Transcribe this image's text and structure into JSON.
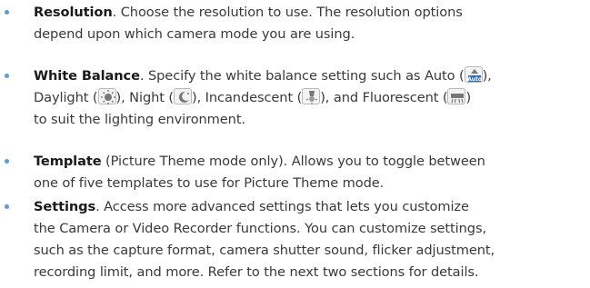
{
  "bullet_color": "#5b9bd5",
  "items": [
    {
      "term": "Resolution",
      "rest": ". Choose the resolution to use. The resolution options",
      "line2": "depend upon which camera mode you are using."
    },
    {
      "term": "White Balance",
      "rest": ". Specify the white balance setting such as Auto (",
      "rest_end": "),",
      "line2a": "Daylight (",
      "line2b": "), Night (",
      "line2c": "), Incandescent (",
      "line2d": "), and Fluorescent (",
      "line2e": ")",
      "line3": "to suit the lighting environment.",
      "icons": [
        "auto-white-balance-icon",
        "daylight-icon",
        "night-icon",
        "incandescent-icon",
        "fluorescent-icon"
      ],
      "icon_auto_label": "Auto"
    },
    {
      "term": "Template",
      "rest": " (Picture Theme mode only). Allows you to toggle between",
      "line2": "one of five templates to use for Picture Theme mode."
    },
    {
      "term": "Settings",
      "rest": ". Access more advanced settings that lets you customize",
      "line2": "the Camera or Video Recorder functions. You can customize settings,",
      "line3": "such as the capture format, camera shutter sound, flicker adjustment,",
      "line4": "recording limit, and more. Refer to the next two sections for details."
    }
  ]
}
